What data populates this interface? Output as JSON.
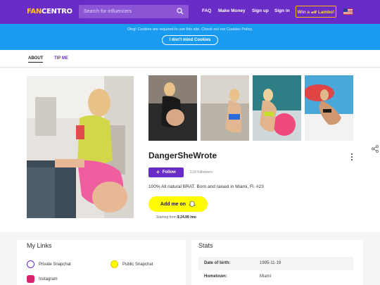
{
  "header": {
    "logo_primary": "FAN",
    "logo_secondary": "CENTRO",
    "search_placeholder": "Search for influencers",
    "nav": [
      "FAQ",
      "Make Money",
      "Sign up",
      "Sign in"
    ],
    "win_label": "Win a 🏎 Lambo!"
  },
  "cookie": {
    "text": "Oing! Cookies are required to use this site. Check out our Cookies Policy.",
    "button": "I don't mind Cookies"
  },
  "tabs": [
    "ABOUT",
    "TIP ME"
  ],
  "profile": {
    "username": "DangerSheWrote",
    "follow_label": "Follow",
    "followers": "119 followers",
    "bio": "100% All natural BRAT. Born and raised in Miami, Fl. #23",
    "snap_label": "Add me on",
    "starting_prefix": "Starting from",
    "starting_price": "$ 24.99 /mo"
  },
  "links": {
    "title": "My Links",
    "items": [
      "Private Snapchat",
      "Public Snapchat",
      "Instagram"
    ]
  },
  "stats": {
    "title": "Stats",
    "rows": [
      {
        "key": "Date of birth:",
        "value": "1995-11-19"
      },
      {
        "key": "Hometown:",
        "value": "Miami"
      }
    ]
  },
  "colors": {
    "brand": "#6a2cc7",
    "cookie_bar": "#1a9bf0",
    "snap_yellow": "#fffc00"
  }
}
